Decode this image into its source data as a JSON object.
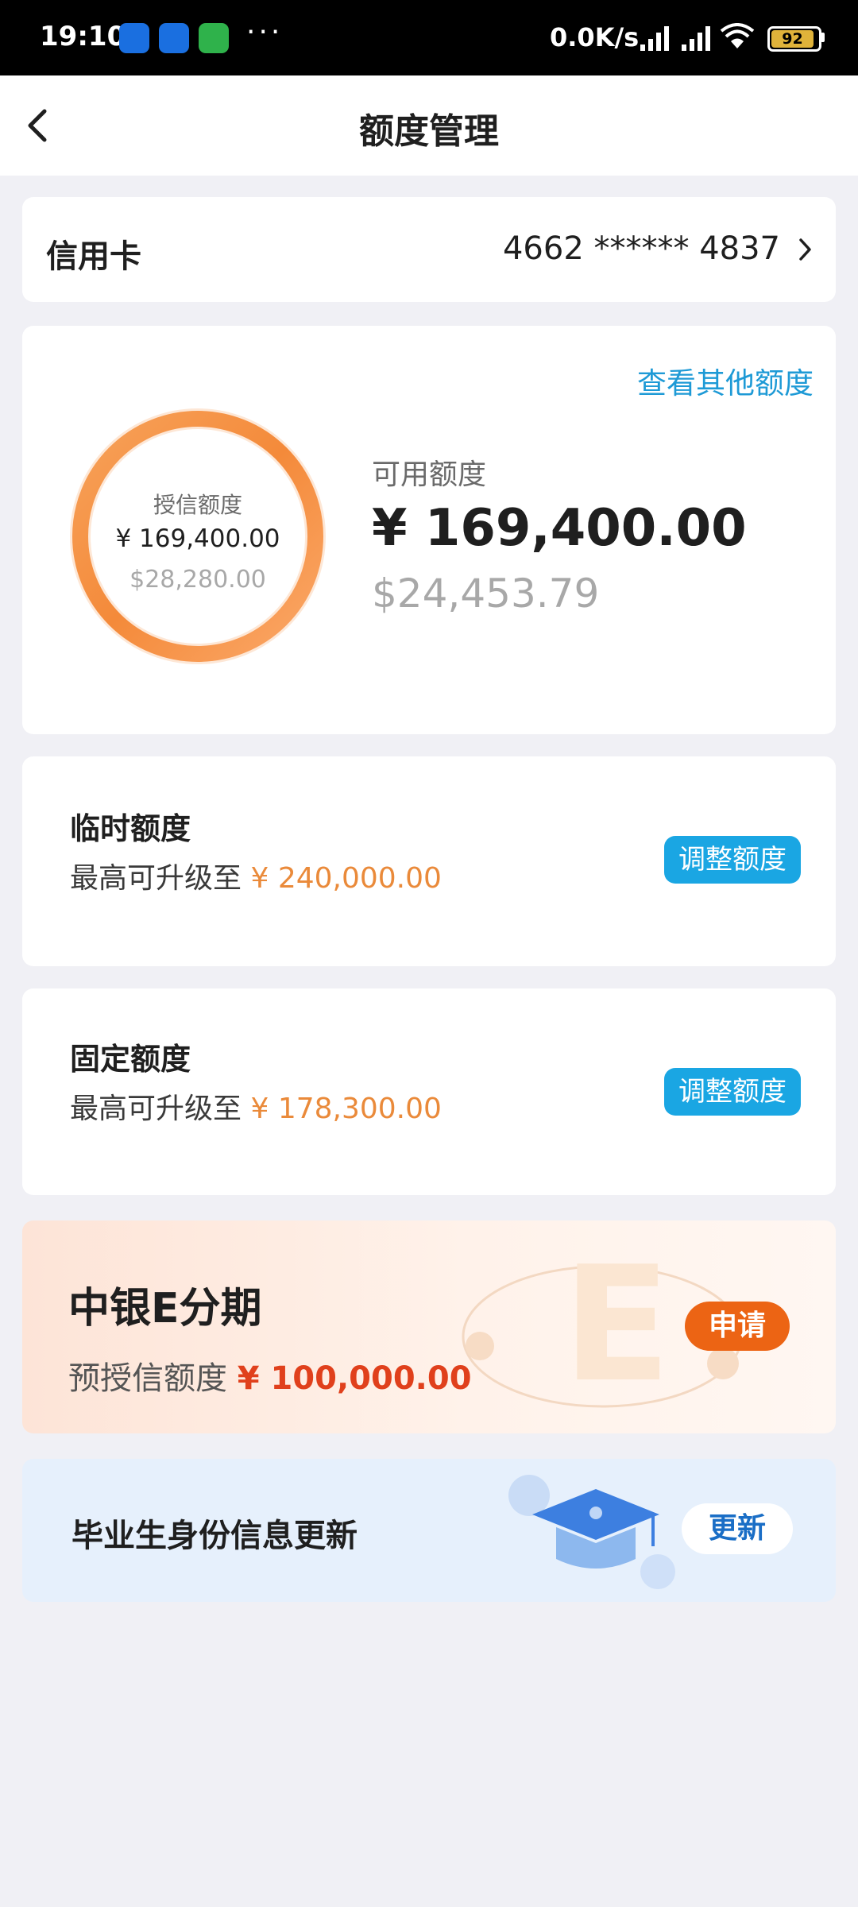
{
  "status_bar": {
    "time": "19:10",
    "more": "···",
    "net_speed": "0.0K/s",
    "battery": "92",
    "battery_level": 0.92
  },
  "nav": {
    "title": "额度管理"
  },
  "credit_card": {
    "label": "信用卡",
    "number": "4662 ****** 4837"
  },
  "summary": {
    "view_other_link": "查看其他额度",
    "ring_label": "授信额度",
    "ring_cny": "¥ 169,400.00",
    "ring_usd": "$28,280.00",
    "available_label": "可用额度",
    "available_cny": "¥ 169,400.00",
    "available_usd": "$24,453.79"
  },
  "temporary_limit": {
    "title": "临时额度",
    "desc_prefix": "最高可升级至",
    "amount": "¥ 240,000.00",
    "button": "调整额度"
  },
  "fixed_limit": {
    "title": "固定额度",
    "desc_prefix": "最高可升级至",
    "amount": "¥ 178,300.00",
    "button": "调整额度"
  },
  "e_installment": {
    "title": "中银E分期",
    "desc_prefix": "预授信额度",
    "amount": "¥ 100,000.00",
    "button": "申请"
  },
  "graduate_update": {
    "title": "毕业生身份信息更新",
    "button": "更新"
  },
  "colors": {
    "accent_blue": "#1aa6e3",
    "amount_orange": "#ea8a3a",
    "apply_orange": "#ec6414",
    "page_bg": "#f0f0f5"
  }
}
